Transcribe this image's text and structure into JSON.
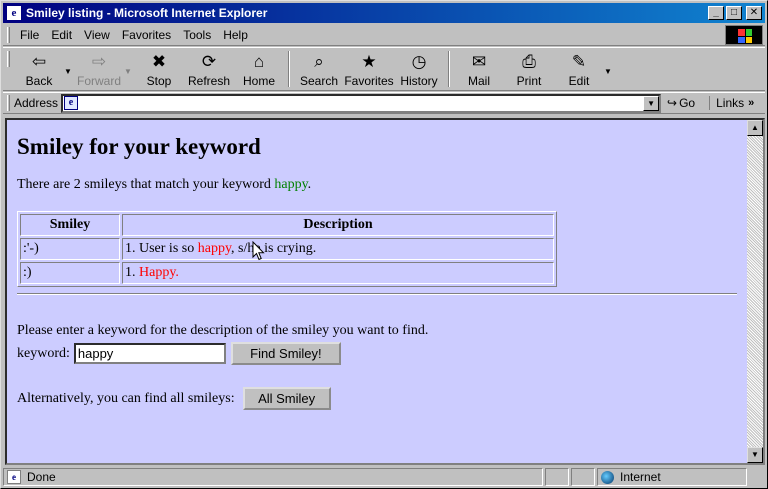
{
  "window": {
    "title": "Smiley listing - Microsoft Internet Explorer",
    "minimize_glyph": "_",
    "maximize_glyph": "□",
    "close_glyph": "✕"
  },
  "menubar": {
    "items": [
      {
        "label": "File",
        "hotkey": "F"
      },
      {
        "label": "Edit",
        "hotkey": "E"
      },
      {
        "label": "View",
        "hotkey": "V"
      },
      {
        "label": "Favorites",
        "hotkey": "a"
      },
      {
        "label": "Tools",
        "hotkey": "T"
      },
      {
        "label": "Help",
        "hotkey": "H"
      }
    ]
  },
  "toolbar": {
    "back": {
      "label": "Back",
      "icon": "⇦"
    },
    "forward": {
      "label": "Forward",
      "icon": "⇨"
    },
    "stop": {
      "label": "Stop",
      "icon": "✖"
    },
    "refresh": {
      "label": "Refresh",
      "icon": "⟳"
    },
    "home": {
      "label": "Home",
      "icon": "⌂"
    },
    "search": {
      "label": "Search",
      "icon": "⌕"
    },
    "favorites": {
      "label": "Favorites",
      "icon": "★"
    },
    "history": {
      "label": "History",
      "icon": "◷"
    },
    "mail": {
      "label": "Mail",
      "icon": "✉"
    },
    "print": {
      "label": "Print",
      "icon": "⎙"
    },
    "edit": {
      "label": "Edit",
      "icon": "✎"
    },
    "dropdown_glyph": "▼"
  },
  "addressbar": {
    "label": "Address",
    "value": "",
    "go_label": "Go",
    "links_label": "Links",
    "links_chevron": "»"
  },
  "page": {
    "heading": "Smiley for your keyword",
    "intro_prefix": "There are 2 smileys that match your keyword ",
    "intro_keyword": "happy",
    "intro_suffix": ".",
    "table": {
      "headers": [
        "Smiley",
        "Description"
      ],
      "rows": [
        {
          "smiley": ":'-)",
          "desc_prefix": "1. User is so ",
          "desc_highlight": "happy",
          "desc_suffix": ", s/he is crying."
        },
        {
          "smiley": ":)",
          "desc_prefix": "1. ",
          "desc_highlight": "Happy.",
          "desc_suffix": ""
        }
      ]
    },
    "search_prompt": "Please enter a keyword for the description of the smiley you want to find.",
    "keyword_label": "keyword:",
    "keyword_value": "happy",
    "find_button": "Find Smiley!",
    "alternative_text": "Alternatively, you can find all smileys:",
    "all_button": "All Smiley"
  },
  "statusbar": {
    "status_text": "Done",
    "zone_text": "Internet"
  },
  "colors": {
    "page_background": "#ccccff",
    "keyword_green": "#008000",
    "highlight_red": "#ff0000",
    "titlebar": "#000080"
  }
}
